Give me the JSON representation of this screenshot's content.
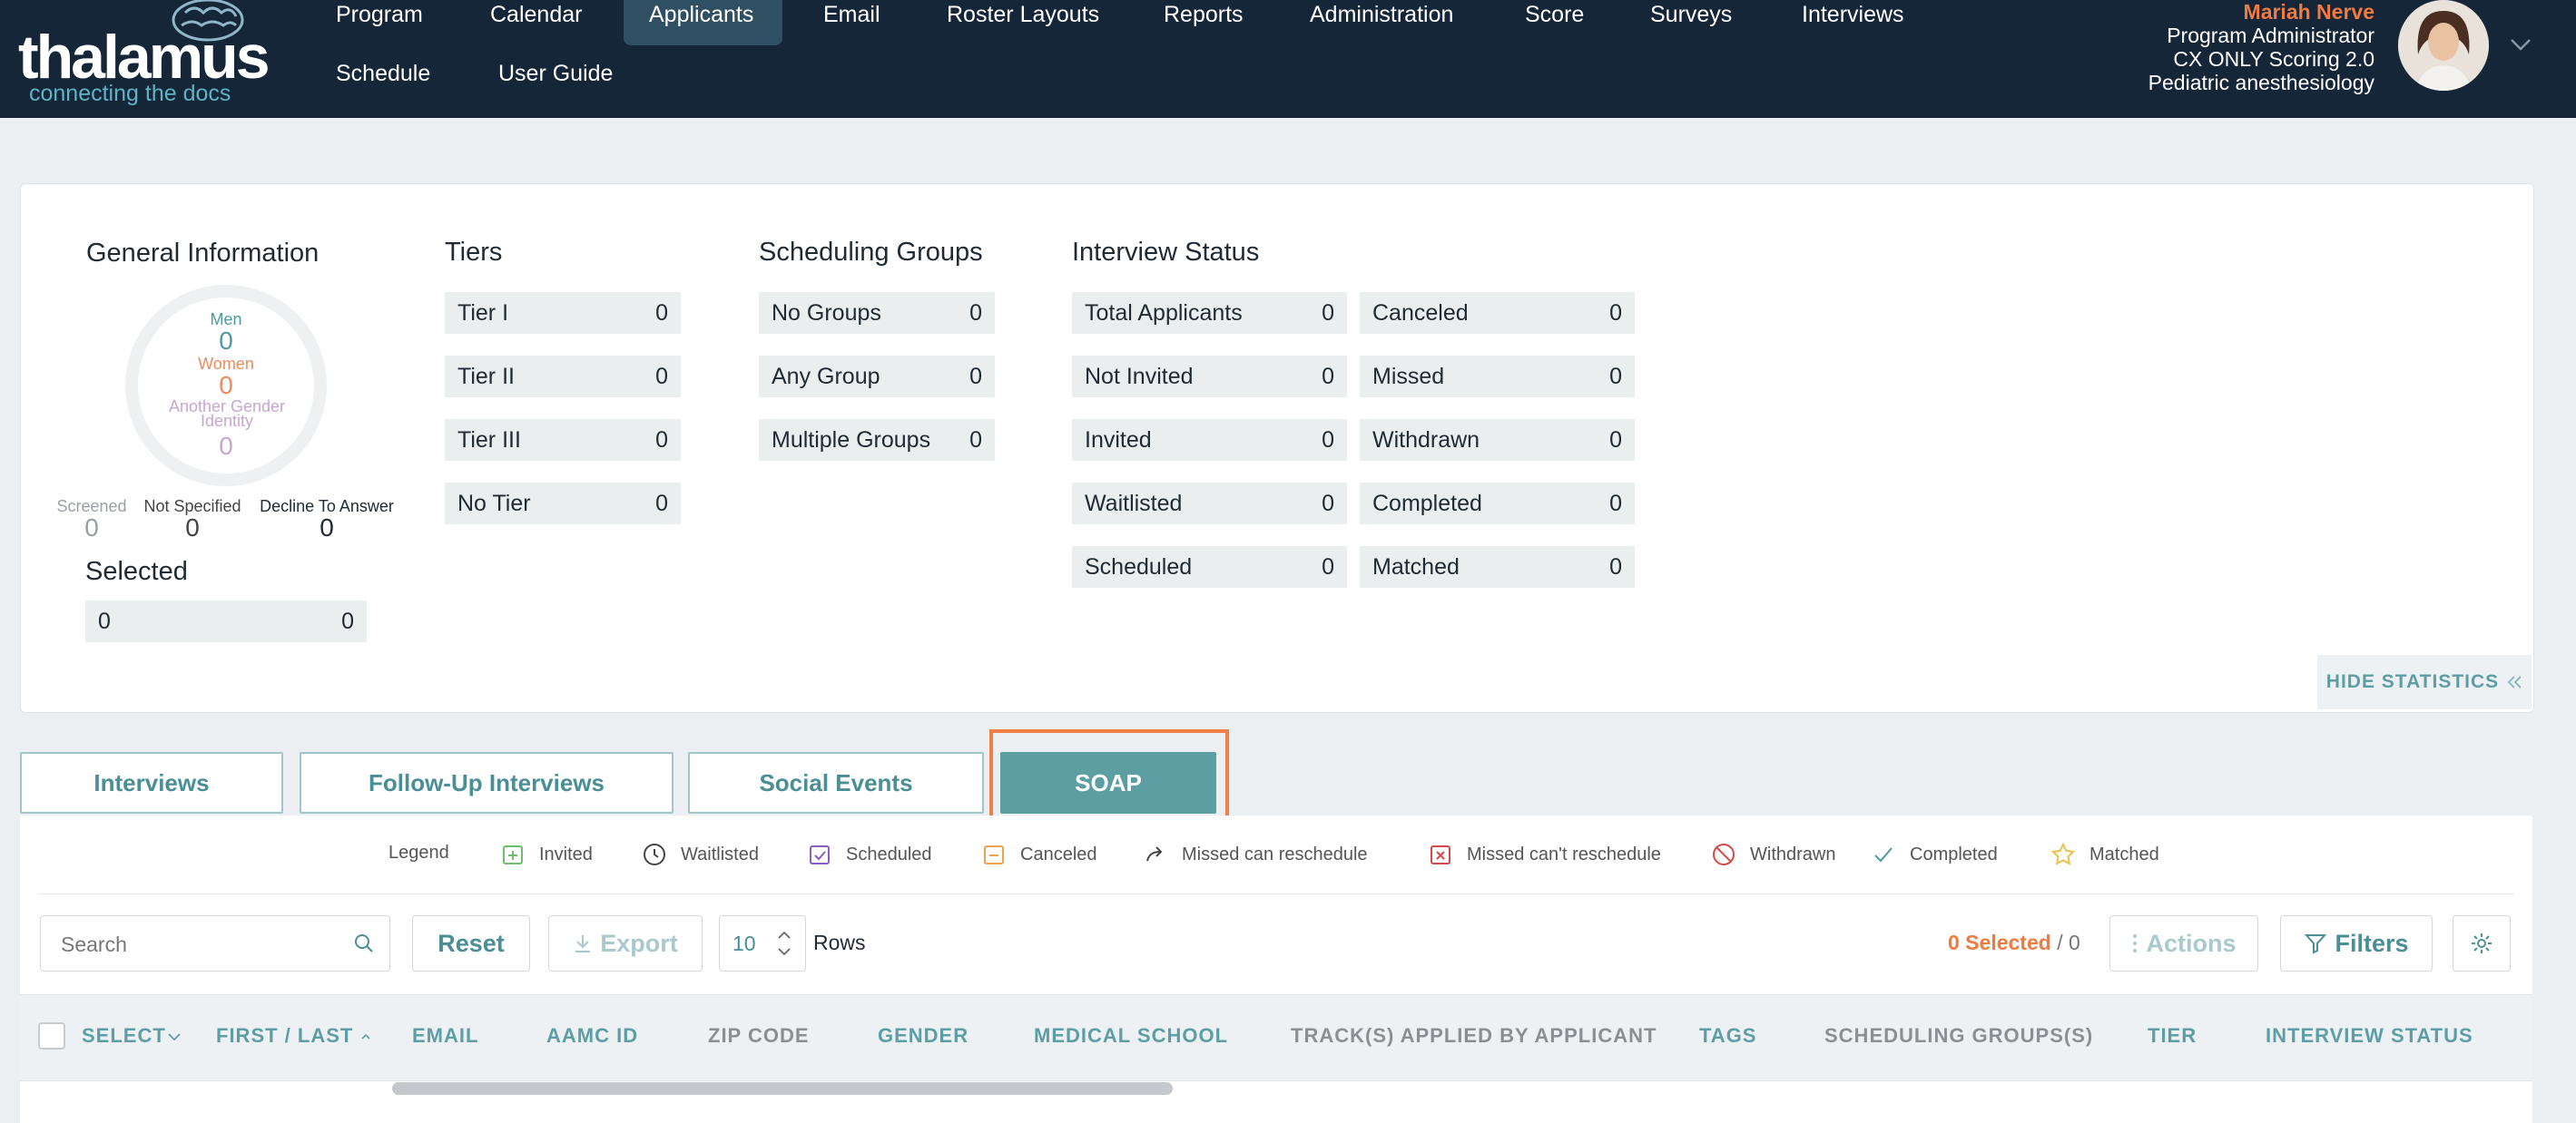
{
  "header": {
    "logo_text": "thalamus",
    "logo_tagline": "connecting the docs",
    "nav_row1": [
      "Program",
      "Calendar",
      "Applicants",
      "Email",
      "Roster Layouts",
      "Reports",
      "Administration",
      "Score",
      "Surveys",
      "Interviews"
    ],
    "nav_row2": [
      "Schedule",
      "User Guide"
    ],
    "active_nav": "Applicants",
    "user": {
      "name": "Mariah Nerve",
      "role": "Program Administrator",
      "program": "CX ONLY Scoring 2.0",
      "specialty": "Pediatric anesthesiology"
    }
  },
  "stats": {
    "general": {
      "title": "General Information",
      "men_label": "Men",
      "men_value": "0",
      "women_label": "Women",
      "women_value": "0",
      "other_label": "Another Gender Identity",
      "other_value": "0",
      "screened_label": "Screened",
      "screened_value": "0",
      "not_specified_label": "Not Specified",
      "not_specified_value": "0",
      "decline_label": "Decline To Answer",
      "decline_value": "0",
      "colors": {
        "men": "#4f9aa1",
        "women": "#ef8a5f",
        "other": "#c9a6cf"
      }
    },
    "selected": {
      "title": "Selected",
      "left": "0",
      "right": "0"
    },
    "tiers": {
      "title": "Tiers",
      "rows": [
        {
          "label": "Tier I",
          "value": "0"
        },
        {
          "label": "Tier II",
          "value": "0"
        },
        {
          "label": "Tier III",
          "value": "0"
        },
        {
          "label": "No Tier",
          "value": "0"
        }
      ]
    },
    "scheduling_groups": {
      "title": "Scheduling Groups",
      "rows": [
        {
          "label": "No Groups",
          "value": "0"
        },
        {
          "label": "Any Group",
          "value": "0"
        },
        {
          "label": "Multiple Groups",
          "value": "0"
        }
      ]
    },
    "interview_status": {
      "title": "Interview Status",
      "left": [
        {
          "label": "Total Applicants",
          "value": "0"
        },
        {
          "label": "Not Invited",
          "value": "0"
        },
        {
          "label": "Invited",
          "value": "0"
        },
        {
          "label": "Waitlisted",
          "value": "0"
        },
        {
          "label": "Scheduled",
          "value": "0"
        }
      ],
      "right": [
        {
          "label": "Canceled",
          "value": "0"
        },
        {
          "label": "Missed",
          "value": "0"
        },
        {
          "label": "Withdrawn",
          "value": "0"
        },
        {
          "label": "Completed",
          "value": "0"
        },
        {
          "label": "Matched",
          "value": "0"
        }
      ]
    },
    "hide_label": "HIDE STATISTICS"
  },
  "tabs": [
    "Interviews",
    "Follow-Up Interviews",
    "Social Events",
    "SOAP"
  ],
  "active_tab": "SOAP",
  "legend": {
    "title": "Legend",
    "items": [
      {
        "label": "Invited",
        "icon": "invited-icon"
      },
      {
        "label": "Waitlisted",
        "icon": "clock-icon"
      },
      {
        "label": "Scheduled",
        "icon": "calendar-check-icon"
      },
      {
        "label": "Canceled",
        "icon": "calendar-minus-icon"
      },
      {
        "label": "Missed can reschedule",
        "icon": "reschedule-arrow-icon"
      },
      {
        "label": "Missed can't reschedule",
        "icon": "calendar-x-icon"
      },
      {
        "label": "Withdrawn",
        "icon": "ban-icon"
      },
      {
        "label": "Completed",
        "icon": "check-icon"
      },
      {
        "label": "Matched",
        "icon": "star-icon"
      }
    ]
  },
  "toolbar": {
    "search_placeholder": "Search",
    "reset_label": "Reset",
    "export_label": "Export",
    "rows_value": "10",
    "rows_label": "Rows",
    "selected_text": "0 Selected",
    "total_text": "/ 0",
    "actions_label": "Actions",
    "filters_label": "Filters"
  },
  "table": {
    "columns": [
      "SELECT",
      "FIRST / LAST",
      "EMAIL",
      "AAMC ID",
      "ZIP CODE",
      "GENDER",
      "MEDICAL SCHOOL",
      "TRACK(S) APPLIED BY APPLICANT",
      "TAGS",
      "SCHEDULING GROUPS(S)",
      "TIER",
      "INTERVIEW STATUS"
    ]
  }
}
